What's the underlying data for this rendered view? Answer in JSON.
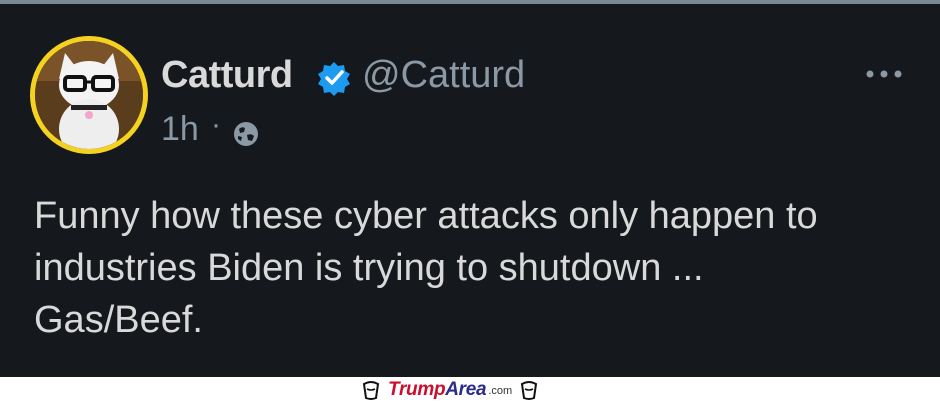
{
  "tweet": {
    "author_name": "Catturd",
    "handle": "@Catturd",
    "time": "1h",
    "separator": "·",
    "text": "Funny how these cyber attacks only happen to\nindustries Biden is trying to shutdown ...\nGas/Beef.",
    "avatar_icon": "cat-with-glasses-avatar",
    "verified_icon": "verified-badge-icon",
    "audience_icon": "globe-icon",
    "more_icon": "more-horizontal-icon"
  },
  "watermark": {
    "brand_main": "Trump",
    "brand_accent": "Area",
    "brand_tld": ".com",
    "icon": "cup-icon"
  },
  "colors": {
    "background": "#15181c",
    "text_primary": "#d9d9d9",
    "text_secondary": "#8b98a5",
    "verified": "#1d9bf0",
    "avatar_ring": "#f4d21f",
    "brand_red": "#c8102e",
    "brand_blue": "#2c2c8a"
  }
}
